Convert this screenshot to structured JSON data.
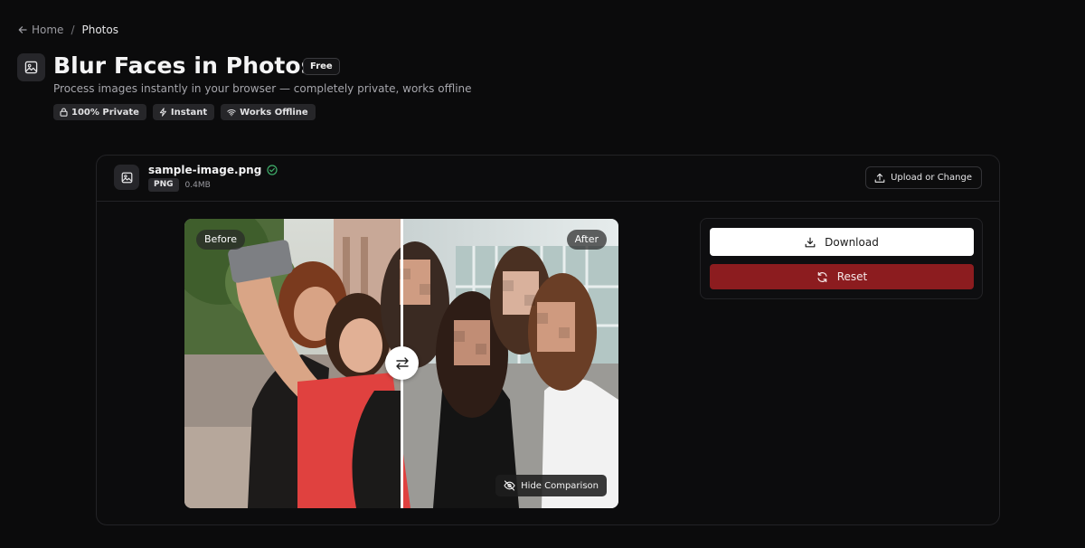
{
  "breadcrumb": {
    "home": "Home",
    "separator": "/",
    "current": "Photos"
  },
  "header": {
    "title": "Blur Faces in Photos",
    "badge": "Free",
    "subtitle": "Process images instantly in your browser — completely private, works offline",
    "chips": [
      {
        "icon": "lock-icon",
        "label": "100% Private"
      },
      {
        "icon": "bolt-icon",
        "label": "Instant"
      },
      {
        "icon": "wifi-icon",
        "label": "Works Offline"
      }
    ]
  },
  "file": {
    "name": "sample-image.png",
    "type": "PNG",
    "size": "0.4MB",
    "upload_label": "Upload or Change"
  },
  "comparison": {
    "before_label": "Before",
    "after_label": "After",
    "hide_label": "Hide Comparison"
  },
  "actions": {
    "download_label": "Download",
    "reset_label": "Reset"
  },
  "colors": {
    "background": "#0b0b0c",
    "reset_button": "#8c1c1f",
    "success_check": "#3fae6a"
  }
}
